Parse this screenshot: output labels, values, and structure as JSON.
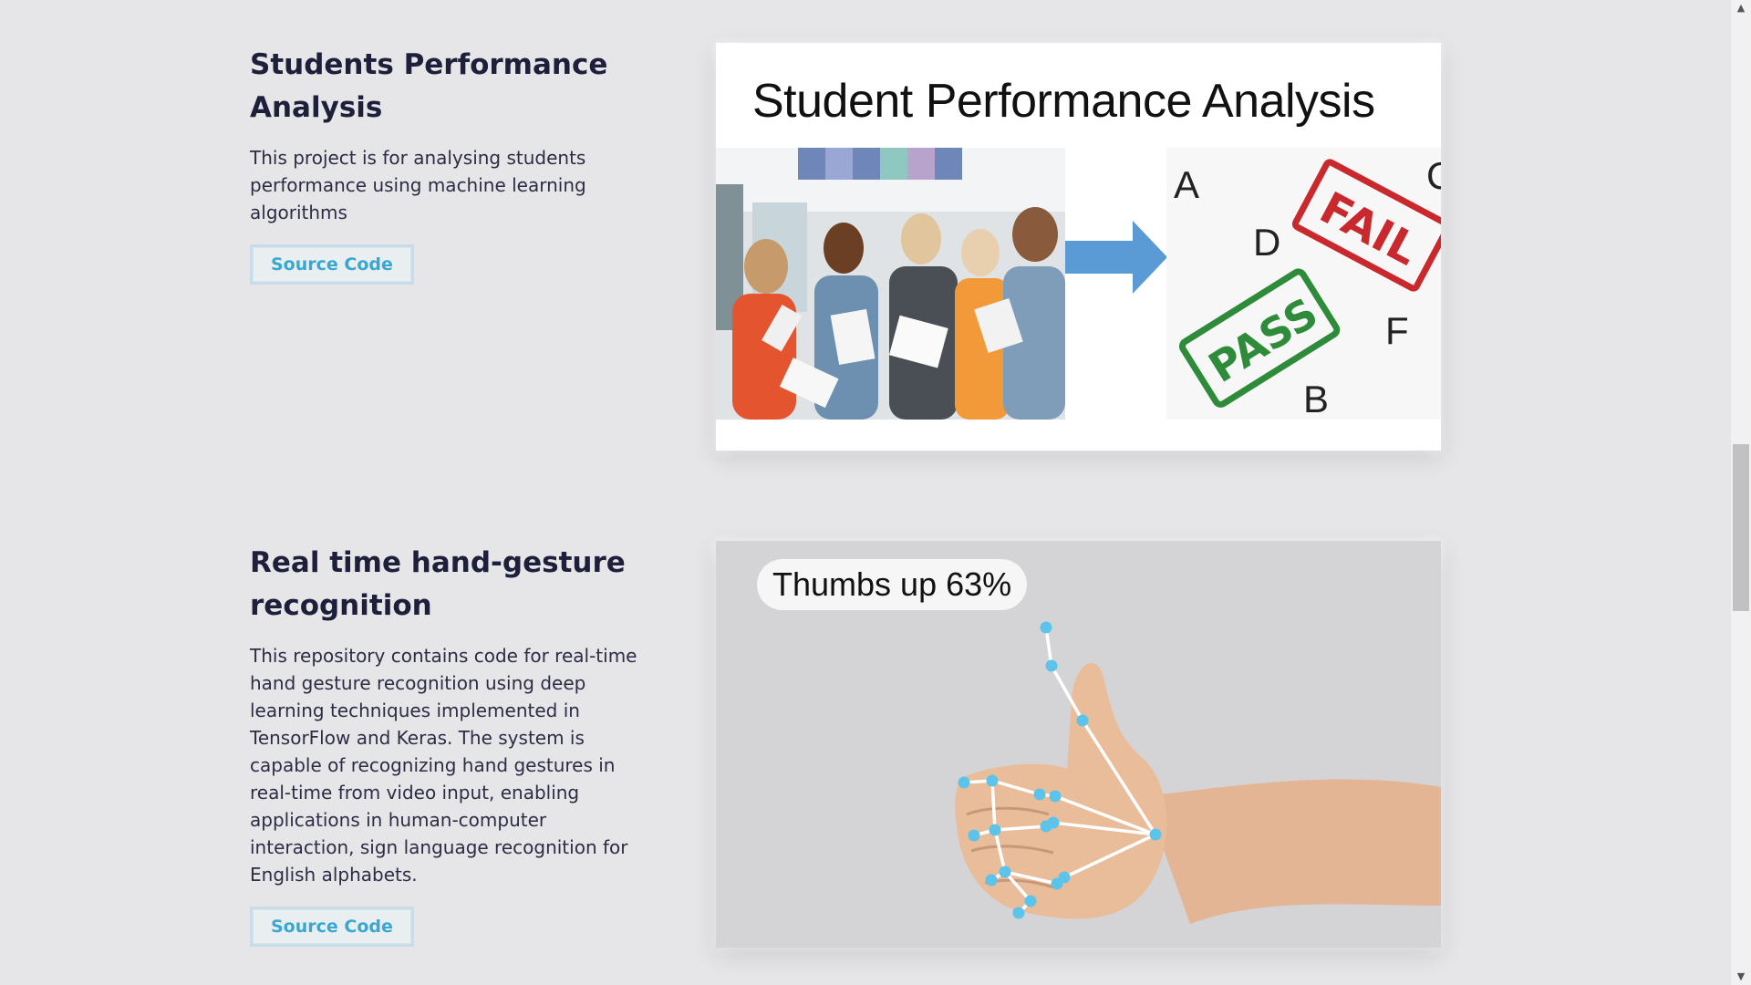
{
  "projects": [
    {
      "title": "Students Performance Analysis",
      "description": "This project is for analysing students performance using machine learning algorithms",
      "button_label": "Source Code",
      "image": {
        "slide_title": "Student Performance Analysis",
        "grade_letters": [
          "A",
          "C",
          "D",
          "F",
          "B"
        ],
        "stamps": [
          "FAIL",
          "PASS"
        ]
      }
    },
    {
      "title": "Real time hand-gesture recognition",
      "description": "This repository contains code for real-time hand gesture recognition using deep learning techniques implemented in TensorFlow and Keras. The system is capable of recognizing hand gestures in real-time from video input, enabling applications in human-computer interaction, sign language recognition for English alphabets.",
      "button_label": "Source Code",
      "image": {
        "prediction_label": "Thumbs up 63%"
      }
    }
  ],
  "colors": {
    "background": "#e6e6e8",
    "title": "#1e1f3b",
    "button_text": "#3aa7d0",
    "landmark": "#5cc3ea",
    "arrow": "#5b9bd5",
    "fail_stamp": "#c9282d",
    "pass_stamp": "#2e8b3a"
  },
  "scrollbar": {
    "up_icon": "chevron-up-icon",
    "down_icon": "chevron-down-icon"
  }
}
